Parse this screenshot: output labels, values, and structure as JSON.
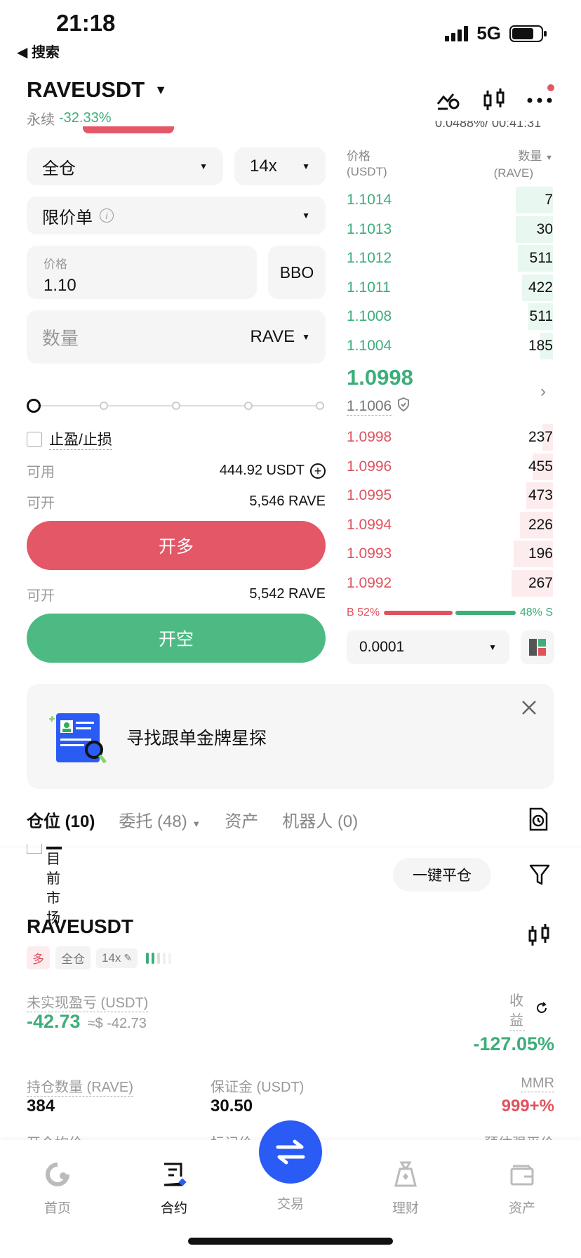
{
  "status_bar": {
    "time": "21:18",
    "back_label": "◀ 搜索",
    "network": "5G"
  },
  "header": {
    "pair": "RAVEUSDT",
    "contract_type": "永续",
    "change": "-32.33%",
    "funding_partial": "0.0488%/ 00:41:31"
  },
  "order_form": {
    "margin_mode": "全仓",
    "leverage": "14x",
    "order_type": "限价单",
    "price_label": "价格",
    "price_value": "1.10",
    "bbo_label": "BBO",
    "qty_placeholder": "数量",
    "qty_unit": "RAVE",
    "tpsl_label": "止盈/止损",
    "available_label": "可用",
    "available_value": "444.92 USDT",
    "open_label_long": "可开",
    "open_value_long": "5,546 RAVE",
    "long_button": "开多",
    "open_label_short": "可开",
    "open_value_short": "5,542 RAVE",
    "short_button": "开空"
  },
  "orderbook": {
    "price_header": "价格",
    "price_unit": "(USDT)",
    "qty_header": "数量",
    "qty_unit": "(RAVE)",
    "asks": [
      {
        "price": "1.1014",
        "qty": "7",
        "depth": 0.18
      },
      {
        "price": "1.1013",
        "qty": "30",
        "depth": 0.18
      },
      {
        "price": "1.1012",
        "qty": "511",
        "depth": 0.17
      },
      {
        "price": "1.1011",
        "qty": "422",
        "depth": 0.15
      },
      {
        "price": "1.1008",
        "qty": "511",
        "depth": 0.12
      },
      {
        "price": "1.1004",
        "qty": "185",
        "depth": 0.06
      }
    ],
    "last_price": "1.0998",
    "mark_price": "1.1006",
    "bids": [
      {
        "price": "1.0998",
        "qty": "237",
        "depth": 0.05
      },
      {
        "price": "1.0996",
        "qty": "455",
        "depth": 0.1
      },
      {
        "price": "1.0995",
        "qty": "473",
        "depth": 0.13
      },
      {
        "price": "1.0994",
        "qty": "226",
        "depth": 0.16
      },
      {
        "price": "1.0993",
        "qty": "196",
        "depth": 0.19
      },
      {
        "price": "1.0992",
        "qty": "267",
        "depth": 0.2
      }
    ],
    "buy_ratio": "B 52%",
    "sell_ratio": "48% S",
    "buy_fraction": 0.52,
    "tick_size": "0.0001"
  },
  "banner": {
    "text": "寻找跟单金牌星探"
  },
  "tabs": [
    {
      "label": "仓位",
      "count": "(10)"
    },
    {
      "label": "委托",
      "count": "(48)"
    },
    {
      "label": "资产",
      "count": ""
    },
    {
      "label": "机器人",
      "count": "(0)"
    }
  ],
  "positions": {
    "current_market_label": "目前市场",
    "close_all": "一键平仓",
    "symbol": "RAVEUSDT",
    "side": "多",
    "mode": "全仓",
    "leverage": "14x",
    "unrealized_label": "未实现盈亏 (USDT)",
    "unrealized_value": "-42.73",
    "unrealized_usd": "≈$ -42.73",
    "roe_label": "收益",
    "roe_value": "-127.05%",
    "size_label": "持仓数量 (RAVE)",
    "size_value": "384",
    "margin_label": "保证金 (USDT)",
    "margin_value": "30.50",
    "mmr_label": "MMR",
    "mmr_value": "999+%",
    "entry_label": "开仓均价",
    "mark_label": "标记价",
    "liq_label": "预估强平价"
  },
  "bottom_nav": [
    {
      "label": "首页",
      "icon": "home-icon"
    },
    {
      "label": "合约",
      "icon": "contract-icon"
    },
    {
      "label": "交易",
      "icon": "swap-icon"
    },
    {
      "label": "理财",
      "icon": "finance-icon"
    },
    {
      "label": "资产",
      "icon": "wallet-icon"
    }
  ],
  "colors": {
    "green": "#3dae7a",
    "red": "#e0525e",
    "blue": "#2a5bf5"
  }
}
